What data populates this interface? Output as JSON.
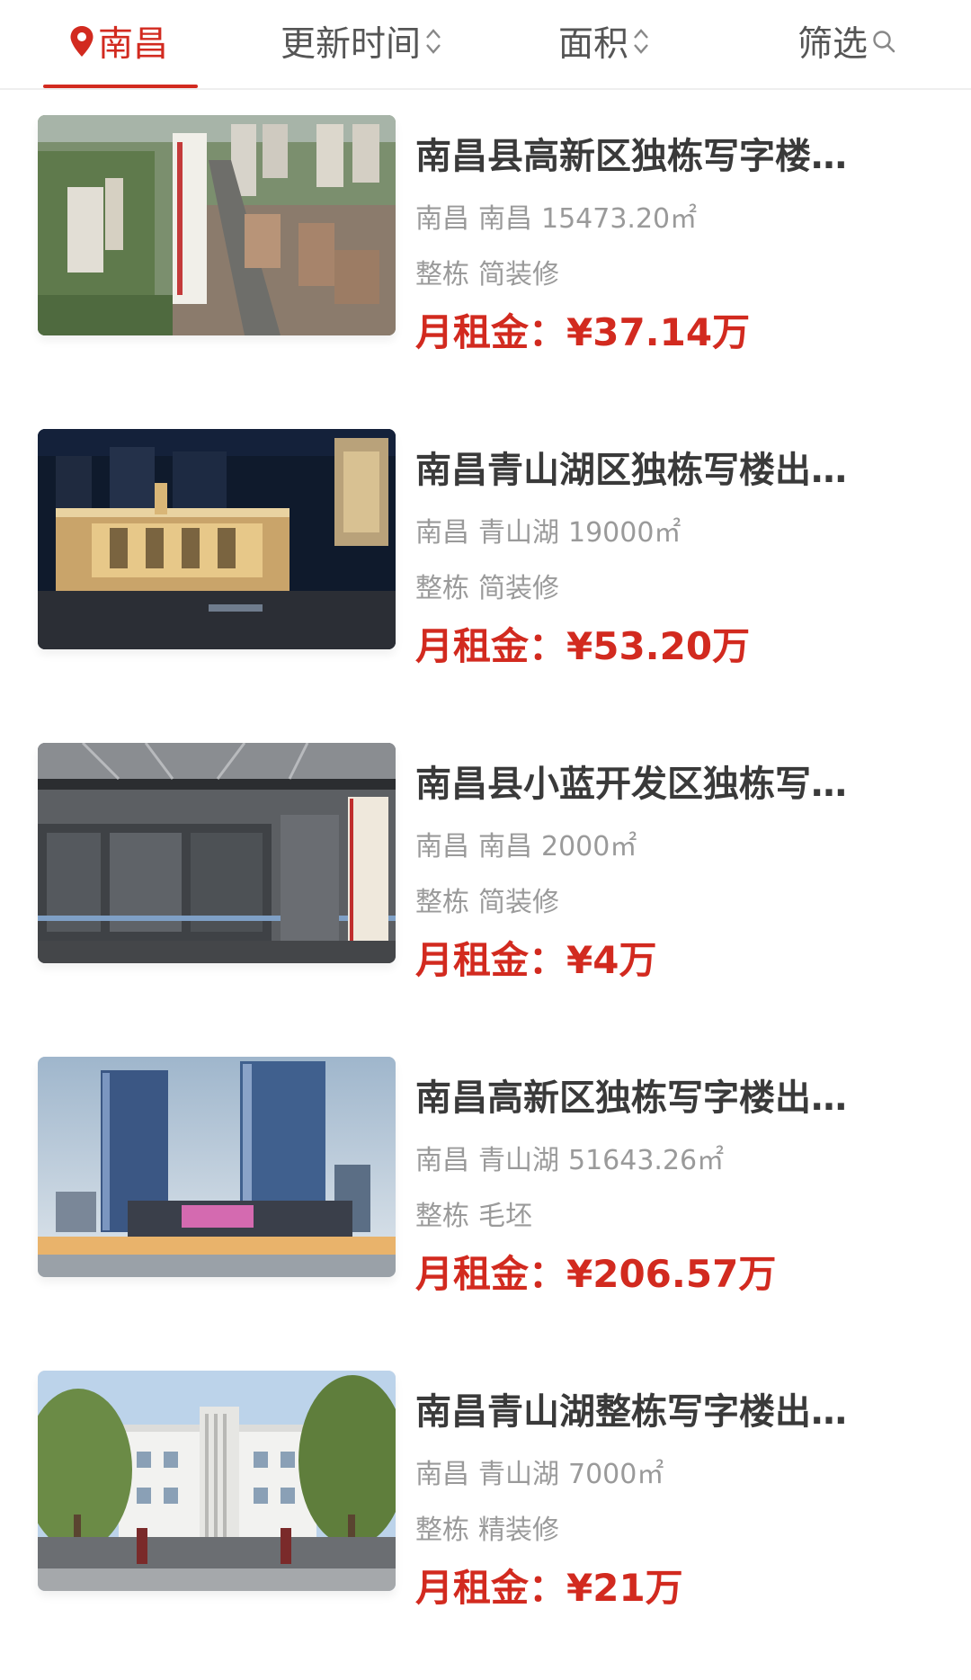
{
  "filter_bar": {
    "city": "南昌",
    "update_time": "更新时间",
    "area": "面积",
    "filter": "筛选"
  },
  "colors": {
    "accent": "#d22a1f",
    "meta_text": "#9a9a9a"
  },
  "listings": [
    {
      "title": "南昌县高新区独栋写字楼出租",
      "title_display": "南昌县高新区独栋写字楼…",
      "city": "南昌",
      "district": "南昌",
      "area": "15473.20㎡",
      "type": "整栋",
      "decoration": "简装修",
      "price_label": "月租金：",
      "price": "¥37.14万",
      "image": "aerial-high-rise-residential"
    },
    {
      "title": "南昌青山湖区独栋写楼出租",
      "title_display": "南昌青山湖区独栋写楼出…",
      "city": "南昌",
      "district": "青山湖",
      "area": "19000㎡",
      "type": "整栋",
      "decoration": "简装修",
      "price_label": "月租金：",
      "price": "¥53.20万",
      "image": "night-lit-classical-building"
    },
    {
      "title": "南昌县小蓝开发区独栋写字楼",
      "title_display": "南昌县小蓝开发区独栋写…",
      "city": "南昌",
      "district": "南昌",
      "area": "2000㎡",
      "type": "整栋",
      "decoration": "简装修",
      "price_label": "月租金：",
      "price": "¥4万",
      "image": "glass-storefront-entrance"
    },
    {
      "title": "南昌高新区独栋写字楼出租",
      "title_display": "南昌高新区独栋写字楼出…",
      "city": "南昌",
      "district": "青山湖",
      "area": "51643.26㎡",
      "type": "整栋",
      "decoration": "毛坯",
      "price_label": "月租金：",
      "price": "¥206.57万",
      "image": "twin-glass-towers"
    },
    {
      "title": "南昌青山湖整栋写字楼出租",
      "title_display": "南昌青山湖整栋写字楼出…",
      "city": "南昌",
      "district": "青山湖",
      "area": "7000㎡",
      "type": "整栋",
      "decoration": "精装修",
      "price_label": "月租金：",
      "price": "¥21万",
      "image": "white-office-building-with-trees"
    }
  ]
}
